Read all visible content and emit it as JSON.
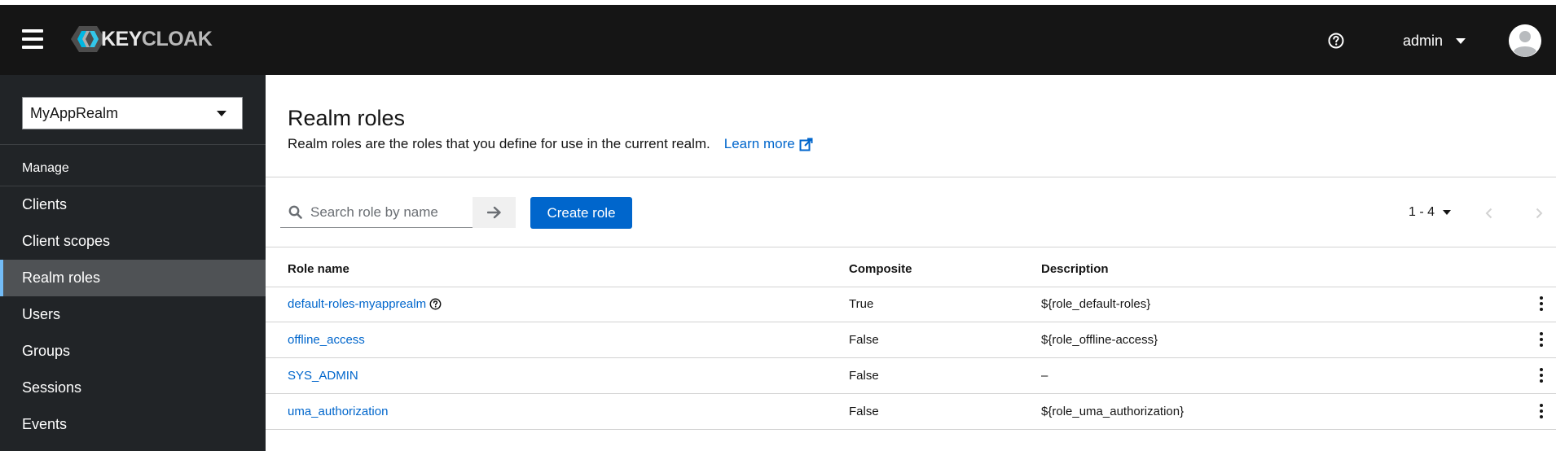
{
  "masthead": {
    "logo_key": "KEY",
    "logo_cloak": "CLOAK",
    "user_name": "admin",
    "icons": [
      "menu-icon",
      "keycloak-logo",
      "help-icon",
      "avatar-icon"
    ]
  },
  "sidebar": {
    "realm": "MyAppRealm",
    "section": "Manage",
    "items": [
      {
        "label": "Clients",
        "active": false
      },
      {
        "label": "Client scopes",
        "active": false
      },
      {
        "label": "Realm roles",
        "active": true
      },
      {
        "label": "Users",
        "active": false
      },
      {
        "label": "Groups",
        "active": false
      },
      {
        "label": "Sessions",
        "active": false
      },
      {
        "label": "Events",
        "active": false
      }
    ]
  },
  "main": {
    "title": "Realm roles",
    "description": "Realm roles are the roles that you define for use in the current realm.",
    "learn_more": "Learn more",
    "search_placeholder": "Search role by name",
    "create_label": "Create role",
    "pagination": "1 - 4",
    "columns": [
      "Role name",
      "Composite",
      "Description"
    ],
    "rows": [
      {
        "name": "default-roles-myapprealm",
        "composite": "True",
        "description": "${role_default-roles}",
        "help": true
      },
      {
        "name": "offline_access",
        "composite": "False",
        "description": "${role_offline-access}",
        "help": false
      },
      {
        "name": "SYS_ADMIN",
        "composite": "False",
        "description": "–",
        "help": false
      },
      {
        "name": "uma_authorization",
        "composite": "False",
        "description": "${role_uma_authorization}",
        "help": false
      }
    ]
  },
  "colors": {
    "masthead": "#151515",
    "sidebar": "#212427",
    "active_nav": "#4f5255",
    "accent": "#0066cc",
    "active_bar": "#73bcf7"
  }
}
